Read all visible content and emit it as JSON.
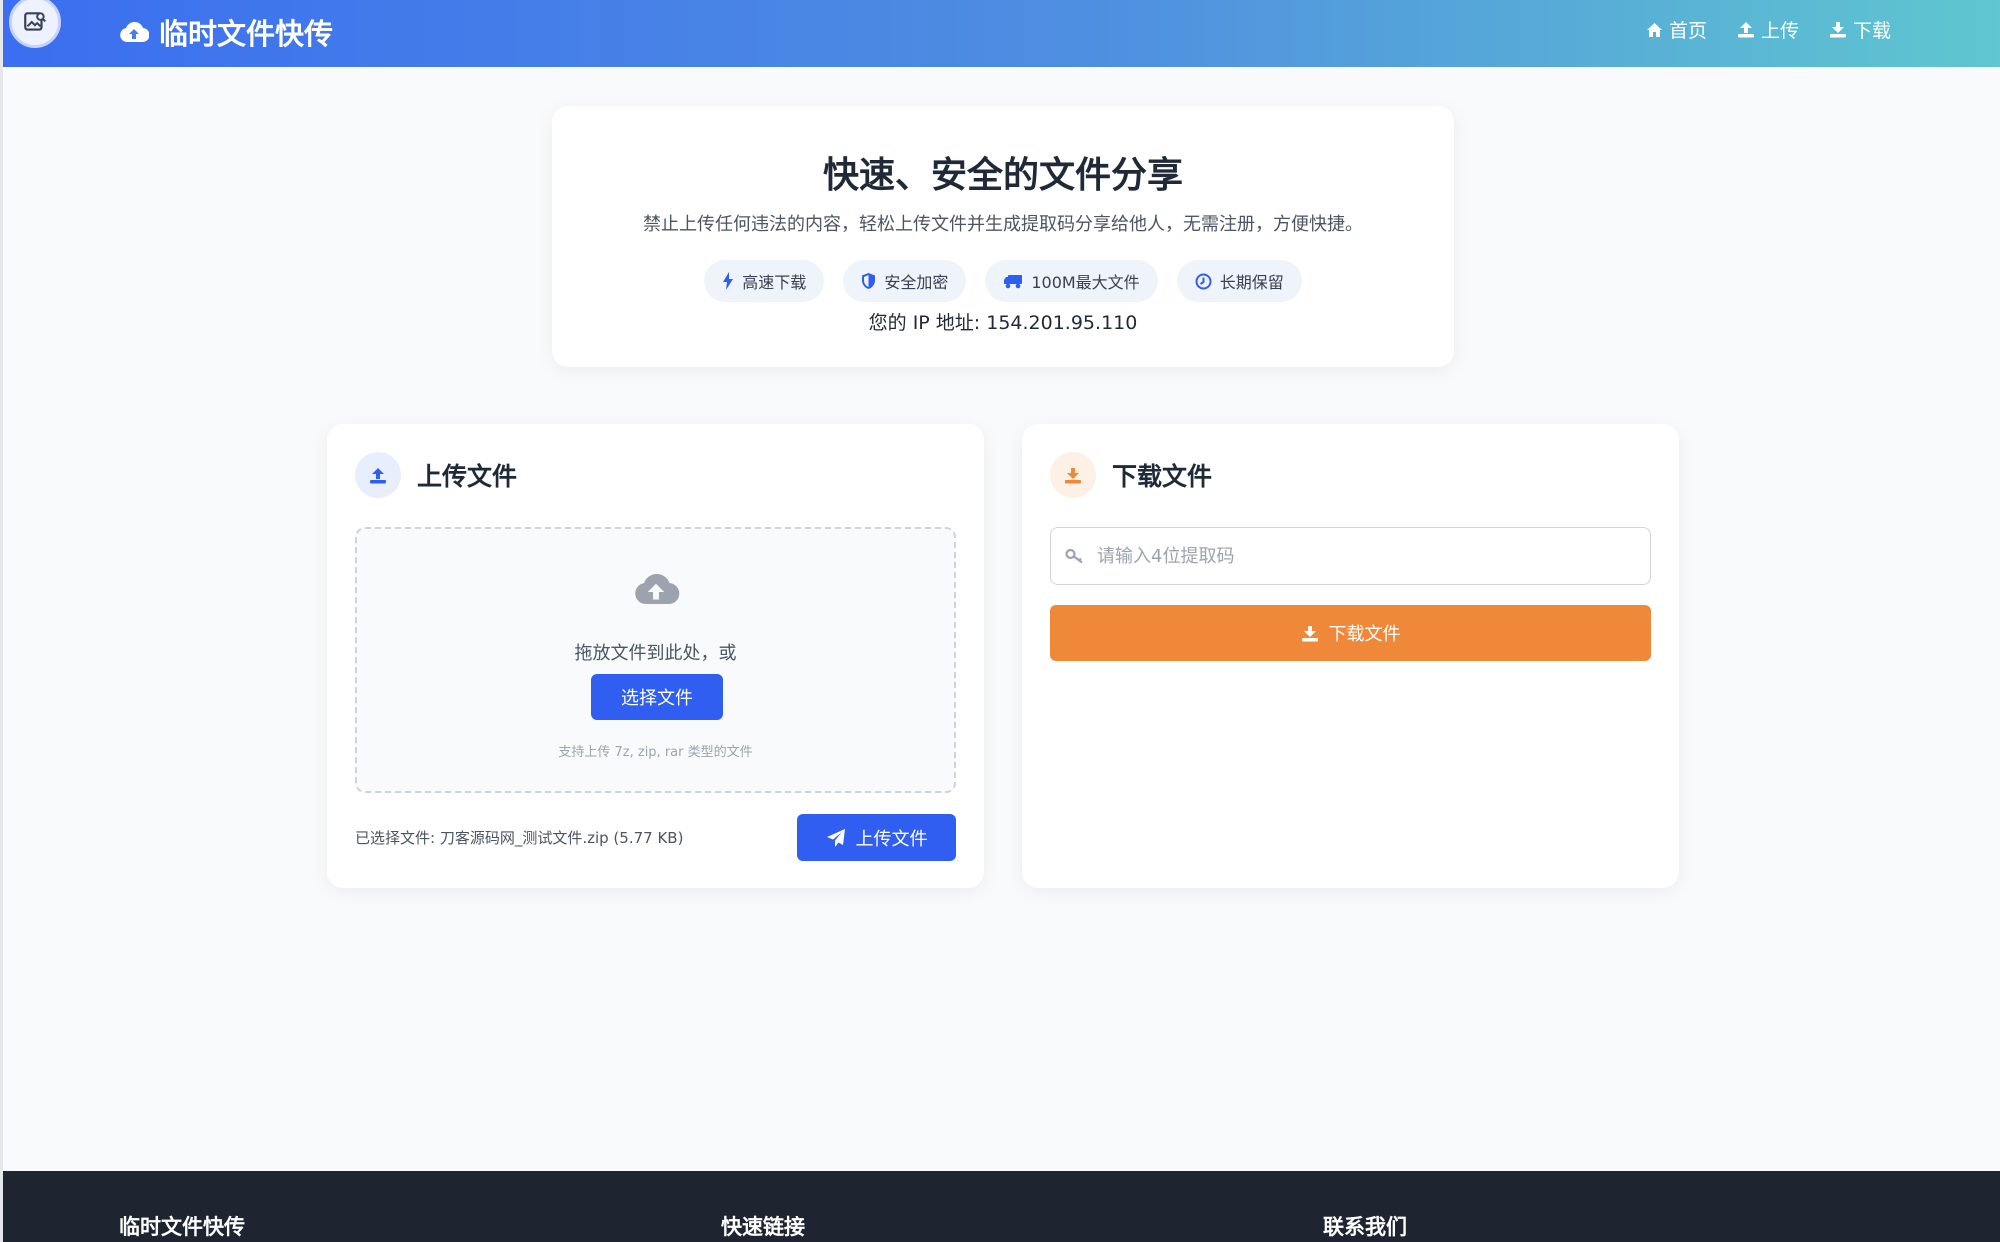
{
  "header": {
    "brand": "临时文件快传",
    "nav": [
      {
        "label": "首页",
        "icon": "home-icon"
      },
      {
        "label": "上传",
        "icon": "upload-icon"
      },
      {
        "label": "下载",
        "icon": "download-icon"
      }
    ]
  },
  "hero": {
    "title": "快速、安全的文件分享",
    "description": "禁止上传任何违法的内容，轻松上传文件并生成提取码分享给他人，无需注册，方便快捷。",
    "badges": [
      {
        "label": "高速下载",
        "icon": "bolt-icon"
      },
      {
        "label": "安全加密",
        "icon": "shield-icon"
      },
      {
        "label": "100M最大文件",
        "icon": "truck-icon"
      },
      {
        "label": "长期保留",
        "icon": "clock-icon"
      }
    ],
    "ip_line": "您的 IP 地址: 154.201.95.110"
  },
  "upload": {
    "title": "上传文件",
    "drop_text": "拖放文件到此处，或",
    "choose_label": "选择文件",
    "hint": "支持上传 7z, zip, rar 类型的文件",
    "selected": "已选择文件: 刀客源码网_测试文件.zip (5.77 KB)",
    "submit_label": "上传文件"
  },
  "download": {
    "title": "下载文件",
    "code_placeholder": "请输入4位提取码",
    "code_value": "",
    "submit_label": "下载文件"
  },
  "footer": {
    "col1": "临时文件快传",
    "col2": "快速链接",
    "col3": "联系我们"
  },
  "colors": {
    "primary": "#2f5ef0",
    "accent": "#f0883a",
    "footer_bg": "#1e2430"
  }
}
